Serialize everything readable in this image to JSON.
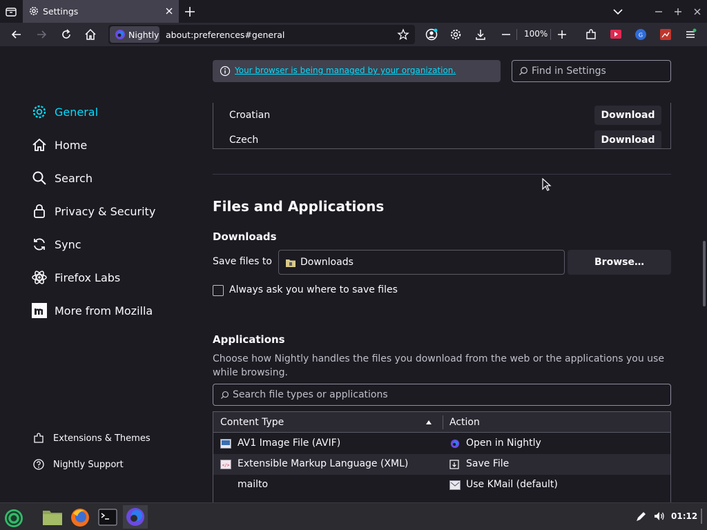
{
  "tab": {
    "title": "Settings"
  },
  "urlbar": {
    "identity_label": "Nightly",
    "url": "about:preferences#general"
  },
  "toolbar": {
    "zoom": "100%"
  },
  "sidebar": {
    "items": [
      {
        "label": "General",
        "active": true
      },
      {
        "label": "Home"
      },
      {
        "label": "Search"
      },
      {
        "label": "Privacy & Security"
      },
      {
        "label": "Sync"
      },
      {
        "label": "Firefox Labs"
      },
      {
        "label": "More from Mozilla"
      }
    ],
    "footer": [
      {
        "label": "Extensions & Themes"
      },
      {
        "label": "Nightly Support"
      }
    ]
  },
  "notice": {
    "text": "Your browser is being managed by your organization."
  },
  "find": {
    "placeholder": "Find in Settings"
  },
  "languages": {
    "rows": [
      {
        "name": "Croatian",
        "action": "Download"
      },
      {
        "name": "Czech",
        "action": "Download"
      }
    ]
  },
  "files": {
    "heading": "Files and Applications",
    "downloads_heading": "Downloads",
    "save_label": "Save files to",
    "save_path": "Downloads",
    "browse_label": "Browse…",
    "always_ask_label": "Always ask you where to save files",
    "always_ask_checked": false
  },
  "applications": {
    "heading": "Applications",
    "description": "Choose how Nightly handles the files you download from the web or the applications you use while browsing.",
    "search_placeholder": "Search file types or applications",
    "columns": [
      "Content Type",
      "Action"
    ],
    "rows": [
      {
        "type": "AV1 Image File (AVIF)",
        "action": "Open in Nightly"
      },
      {
        "type": "Extensible Markup Language (XML)",
        "action": "Save File"
      },
      {
        "type": "mailto",
        "action": "Use KMail (default)"
      }
    ]
  },
  "taskbar": {
    "clock": "01:12"
  },
  "colors": {
    "accent": "#00ddff",
    "background": "#1c1b22",
    "surface": "#2b2a33",
    "taskbar_running": "#35b96a"
  }
}
